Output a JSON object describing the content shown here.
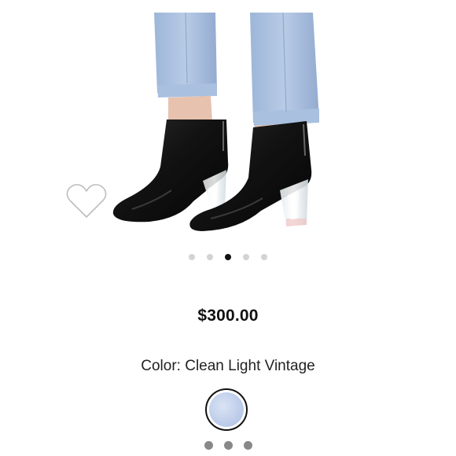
{
  "product": {
    "price": "$300.00",
    "color_label": "Color: Clean Light Vintage",
    "image_semantic": "black-leather-ankle-boots-clear-heel"
  },
  "carousel": {
    "count": 5,
    "active_index": 2
  },
  "swatches": {
    "selected_color": "#b9c9e8",
    "more_indicator_count": 3
  },
  "colors": {
    "accent": "#111111",
    "dot_inactive": "#d3d3d3",
    "more_dots": "#888888"
  },
  "icons": {
    "wishlist": "heart-outline-icon"
  }
}
